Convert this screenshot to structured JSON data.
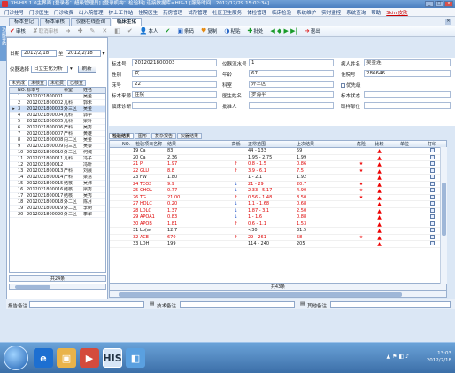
{
  "window": {
    "title": "XH-HIS 1.0主界面  [登录者：超级管理员]  [登录机构：检验科]  连接数据库=HIS-1  [服务时间：2012/12/29 15:02:34]"
  },
  "menu": [
    "门诊挂号",
    "门诊医生",
    "门诊收费",
    "出入院管理",
    "护士工作站",
    "住院医生",
    "药房管理",
    "试剂管理",
    "社区卫生服务",
    "体检管理",
    "临床检验",
    "系统维护",
    "实时监控",
    "系统查询",
    "帮助",
    "Skin 皮肤"
  ],
  "tabs": [
    "标本登记",
    "标本审核",
    "仪器在线查询",
    "临床生化"
  ],
  "side_strip": "功能导航",
  "toolbar": [
    {
      "icon": "✔",
      "label": "审核",
      "cls": "red"
    },
    {
      "icon": "✘",
      "label": "取消审核",
      "cls": "dis"
    },
    {
      "icon": "➜",
      "label": "",
      "cls": "dis"
    },
    {
      "icon": "✚",
      "label": "",
      "cls": "dis"
    },
    {
      "icon": "✎",
      "label": "",
      "cls": "dis"
    },
    {
      "icon": "✕",
      "label": "",
      "cls": "dis"
    },
    {
      "icon": "◧",
      "label": "",
      "cls": "dis"
    },
    {
      "icon": "✔",
      "label": "",
      "cls": "dis"
    },
    {
      "icon": "👤",
      "label": "本人",
      "cls": ""
    },
    {
      "icon": "✔",
      "label": "",
      "cls": "green"
    },
    {
      "icon": "▣",
      "label": "条码",
      "cls": "blue"
    },
    {
      "icon": "♥",
      "label": "复制",
      "cls": "orange"
    },
    {
      "icon": "◑",
      "label": "粘贴",
      "cls": "blue"
    },
    {
      "icon": "✚",
      "label": "批处",
      "cls": "green"
    },
    {
      "icon": "◀ ◆ ▶ ▶|",
      "label": "",
      "cls": "green"
    },
    {
      "icon": "➔",
      "label": "退出",
      "cls": "red"
    }
  ],
  "left": {
    "date_label": "日期",
    "date_from": "2012/2/18",
    "date_sep": "至",
    "date_to": "2012/2/18",
    "instrument_label": "仪器选择",
    "instrument_value": "日立生化分析",
    "refresh_label": "刷新",
    "subtabs": [
      "未完成",
      "未核查",
      "未收费",
      "已核查"
    ],
    "columns": [
      "",
      "NO.",
      "标本号",
      "科室",
      "姓名"
    ],
    "rows": [
      {
        "no": "1",
        "id": "2012021800001",
        "dept": "",
        "name": "吴金"
      },
      {
        "no": "2",
        "id": "2012021800002",
        "dept": "儿科",
        "name": "郭朱"
      },
      {
        "no": "3",
        "id": "2012021800003",
        "dept": "外三区",
        "name": "吴金"
      },
      {
        "no": "4",
        "id": "2012021800004",
        "dept": "儿科",
        "name": "郭学"
      },
      {
        "no": "5",
        "id": "2012021800005",
        "dept": "儿科",
        "name": "梁玲"
      },
      {
        "no": "6",
        "id": "2012021800006",
        "dept": "产科",
        "name": "吴秀"
      },
      {
        "no": "7",
        "id": "2012021800007",
        "dept": "产科",
        "name": "黄雄"
      },
      {
        "no": "8",
        "id": "2012021800008",
        "dept": "内二区",
        "name": "吴金"
      },
      {
        "no": "9",
        "id": "2012021800009",
        "dept": "内三区",
        "name": "吴泰"
      },
      {
        "no": "10",
        "id": "2012021800010",
        "dept": "外二区",
        "name": "何诚"
      },
      {
        "no": "11",
        "id": "2012021800011",
        "dept": "儿科",
        "name": "冯子"
      },
      {
        "no": "12",
        "id": "2012021800012",
        "dept": "",
        "name": "冯昕"
      },
      {
        "no": "13",
        "id": "2012021800013",
        "dept": "产科",
        "name": "刘晨"
      },
      {
        "no": "14",
        "id": "2012021800014",
        "dept": "产科",
        "name": "梁慧"
      },
      {
        "no": "15",
        "id": "2012021800015",
        "dept": "结核",
        "name": "吴沛"
      },
      {
        "no": "16",
        "id": "2012021800016",
        "dept": "结核",
        "name": "梁秀"
      },
      {
        "no": "17",
        "id": "2012021800017",
        "dept": "结核",
        "name": "吴秀"
      },
      {
        "no": "18",
        "id": "2012021800018",
        "dept": "外二区",
        "name": "陈月"
      },
      {
        "no": "19",
        "id": "2012021800019",
        "dept": "外二区",
        "name": "李树"
      },
      {
        "no": "20",
        "id": "2012021800020",
        "dept": "外二区",
        "name": "李翠"
      }
    ],
    "selected_row": 2,
    "footer": "共24条"
  },
  "form": {
    "specimen_no_label": "标本号",
    "specimen_no": "2012021800003",
    "instrument_no_label": "仪器流水号",
    "instrument_no": "1",
    "patient_name_label": "病人姓名",
    "patient_name": "吴金连",
    "gender_label": "性别",
    "gender": "女",
    "age_label": "年龄",
    "age": "67",
    "inpatient_no_label": "住院号",
    "inpatient_no": "286646",
    "bed_label": "床号",
    "bed": "22",
    "dept_label": "科室",
    "dept": "外三区",
    "priority_label": "优先级",
    "source_label": "标本来源",
    "source": "住院",
    "doctor_label": "医生姓名",
    "doctor": "罗海平",
    "specimen_status_label": "标本状态",
    "diagnosis_label": "临床诊断",
    "diagnosis": "",
    "approver_label": "批准人",
    "approver": "",
    "collect_label": "取样部位",
    "collect": ""
  },
  "results": {
    "tabs": [
      "检验结果",
      "图形",
      "复杂报告",
      "仪器结果"
    ],
    "columns": [
      "",
      "NO.",
      "检验项目名称",
      "结果",
      "高低",
      "正常范围",
      "上次结果",
      "危险",
      "比较",
      "单位",
      "打印"
    ],
    "rows": [
      {
        "item": "19 Ca",
        "result": "83",
        "flag": "",
        "range": "44 - 133",
        "last": "59",
        "star": false,
        "red": false
      },
      {
        "item": "20 Ca",
        "result": "2.36",
        "flag": "",
        "range": "1.95 - 2.75",
        "last": "1.99",
        "star": false,
        "red": false
      },
      {
        "item": "21 P",
        "result": "1.97",
        "flag": "↑",
        "range": "0.8 - 1.5",
        "last": "0.86",
        "star": true,
        "red": true
      },
      {
        "item": "22 GLU",
        "result": "8.8",
        "flag": "↑",
        "range": "3.9 - 6.1",
        "last": "7.5",
        "star": true,
        "red": true
      },
      {
        "item": "23 FW",
        "result": "1.80",
        "flag": "",
        "range": "1 - 2.1",
        "last": "1.92",
        "star": false,
        "red": false
      },
      {
        "item": "24 TCO2",
        "result": "9.9",
        "flag": "↓",
        "range": "21 - 29",
        "last": "20.7",
        "star": true,
        "red": true
      },
      {
        "item": "25 CHOL",
        "result": "0.77",
        "flag": "↓",
        "range": "2.33 - 5.17",
        "last": "4.90",
        "star": true,
        "red": true
      },
      {
        "item": "26 TG",
        "result": "21.00",
        "flag": "↑",
        "range": "0.56 - 1.48",
        "last": "8.50",
        "star": true,
        "red": true
      },
      {
        "item": "27 HDLC",
        "result": "0.20",
        "flag": "↓",
        "range": "1.1 - 1.68",
        "last": "0.68",
        "star": false,
        "red": true
      },
      {
        "item": "28 LDLC",
        "result": "1.37",
        "flag": "↓",
        "range": "1.87 - 3.1",
        "last": "2.50",
        "star": false,
        "red": true
      },
      {
        "item": "29 APOA1",
        "result": "0.83",
        "flag": "↓",
        "range": "1 - 1.6",
        "last": "0.88",
        "star": false,
        "red": true
      },
      {
        "item": "30 APOB",
        "result": "1.81",
        "flag": "↑",
        "range": "0.6 - 1.1",
        "last": "1.53",
        "star": false,
        "red": true
      },
      {
        "item": "31 Lp(a)",
        "result": "12.7",
        "flag": "",
        "range": "<30",
        "last": "31.5",
        "star": false,
        "red": false
      },
      {
        "item": "32 ACE",
        "result": "670",
        "flag": "↑",
        "range": "29 - 261",
        "last": "58",
        "star": true,
        "red": true
      },
      {
        "item": "33 LDH",
        "result": "199",
        "flag": "",
        "range": "114 - 240",
        "last": "205",
        "star": false,
        "red": false
      }
    ],
    "footer": "共43条"
  },
  "notes": {
    "report_label": "报告备注",
    "tech_label": "技术备注",
    "other_label": "其他备注"
  },
  "taskbar": {
    "time": "13:03",
    "date": "2012/2/18"
  }
}
